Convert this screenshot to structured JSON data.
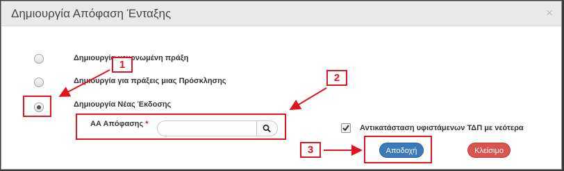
{
  "dialog": {
    "title": "Δημιουργία Απόφαση Ένταξης",
    "close_symbol": "×"
  },
  "options": [
    {
      "label": "Δημιουργία μεμονωμένη πράξη",
      "checked": false
    },
    {
      "label": "Δημιουργία για πράξεις μιας Πρόσκλησης",
      "checked": false
    },
    {
      "label": "Δημιουργία Νέας Έκδοσης",
      "checked": true
    }
  ],
  "field": {
    "label": "ΑΑ Απόφασης",
    "required_mark": "*",
    "value": ""
  },
  "replace_checkbox": {
    "label": "Αντικατάσταση υφιστάμενων ΤΔΠ με νεότερα",
    "checked": true
  },
  "buttons": {
    "accept": "Αποδοχή",
    "close": "Κλείσιμο"
  },
  "annotations": [
    "1",
    "2",
    "3"
  ],
  "colors": {
    "annotation": "#e0141e",
    "accept": "#3b7ab8",
    "close": "#d9534f"
  }
}
